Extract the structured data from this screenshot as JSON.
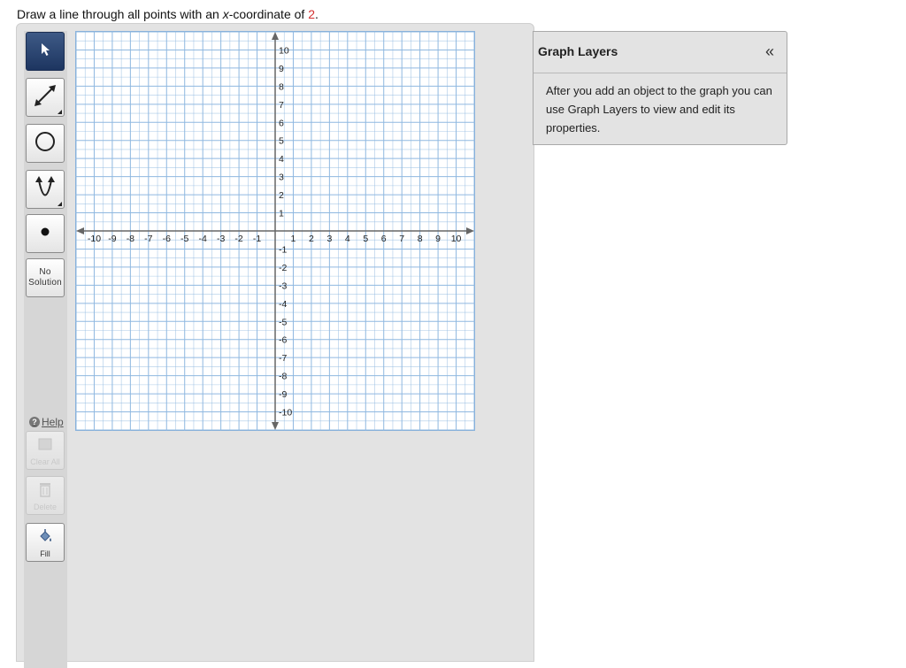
{
  "prompt": {
    "prefix": "Draw a line through all points with an ",
    "variable": "x",
    "middle": "-coordinate of ",
    "value": "2",
    "suffix": "."
  },
  "toolbar": {
    "tools": [
      {
        "name": "pointer",
        "icon": "pointer-arrow-icon",
        "selected": true
      },
      {
        "name": "line",
        "icon": "line-tool-icon",
        "has_submenu": true
      },
      {
        "name": "circle",
        "icon": "circle-tool-icon"
      },
      {
        "name": "parabola",
        "icon": "parabola-tool-icon",
        "has_submenu": true
      },
      {
        "name": "point",
        "icon": "point-tool-icon"
      }
    ],
    "no_solution_line1": "No",
    "no_solution_line2": "Solution",
    "help_label": "Help",
    "clear_all_label": "Clear All",
    "delete_label": "Delete",
    "fill_label": "Fill"
  },
  "graph": {
    "x_ticks": [
      "-10",
      "-9",
      "-8",
      "-7",
      "-6",
      "-5",
      "-4",
      "-3",
      "-2",
      "-1",
      "1",
      "2",
      "3",
      "4",
      "5",
      "6",
      "7",
      "8",
      "9",
      "10"
    ],
    "y_ticks": [
      "10",
      "9",
      "8",
      "7",
      "6",
      "5",
      "4",
      "3",
      "2",
      "1",
      "-1",
      "-2",
      "-3",
      "-4",
      "-5",
      "-6",
      "-7",
      "-8",
      "-9",
      "-10"
    ],
    "x_range": [
      -11,
      11
    ],
    "y_range": [
      -11,
      11
    ],
    "minor_step": 0.5,
    "grid_color": "#8fb8e0",
    "axis_color": "#666666"
  },
  "panel": {
    "title": "Graph Layers",
    "collapse_icon": "double-chevron-left-icon",
    "collapse_glyph": "«",
    "body": "After you add an object to the graph you can use Graph Layers to view and edit its properties."
  },
  "colors": {
    "accent": "#1d3560",
    "highlight": "#d32f2f"
  }
}
